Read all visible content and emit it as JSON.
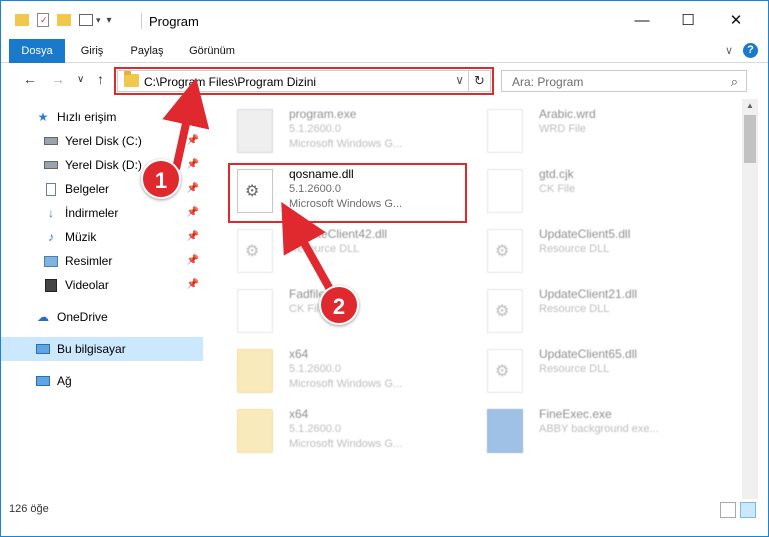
{
  "window": {
    "title": "Program",
    "controls": {
      "minimize": "—",
      "maximize": "☐",
      "close": "✕"
    }
  },
  "ribbon": {
    "tabs": [
      "Dosya",
      "Giriş",
      "Paylaş",
      "Görünüm"
    ],
    "chevron": "∨",
    "help": "?"
  },
  "address": {
    "path": "C:\\Program Files\\Program Dizini",
    "dropdown": "∨",
    "refresh": "↻"
  },
  "search": {
    "placeholder": "Ara: Program",
    "icon": "search-icon"
  },
  "nav": {
    "back": "←",
    "forward": "→",
    "recent": "∨",
    "up": "↑"
  },
  "sidebar": {
    "items": [
      {
        "label": "Hızlı erişim",
        "icon": "star-icon",
        "pinned": false
      },
      {
        "label": "Yerel Disk (C:)",
        "icon": "drive-icon",
        "pinned": true
      },
      {
        "label": "Yerel Disk (D:)",
        "icon": "drive-icon",
        "pinned": true
      },
      {
        "label": "Belgeler",
        "icon": "document-icon",
        "pinned": true
      },
      {
        "label": "İndirmeler",
        "icon": "download-icon",
        "pinned": true
      },
      {
        "label": "Müzik",
        "icon": "music-icon",
        "pinned": true
      },
      {
        "label": "Resimler",
        "icon": "pictures-icon",
        "pinned": true
      },
      {
        "label": "Videolar",
        "icon": "video-icon",
        "pinned": true
      },
      {
        "label": "OneDrive",
        "icon": "cloud-icon",
        "pinned": false
      },
      {
        "label": "Bu bilgisayar",
        "icon": "computer-icon",
        "pinned": false
      },
      {
        "label": "Ağ",
        "icon": "network-icon",
        "pinned": false
      }
    ]
  },
  "files": {
    "left": [
      {
        "name": "program.exe",
        "line1": "5.1.2600.0",
        "line2": "Microsoft Windows G...",
        "kind": "app"
      },
      {
        "name": "qosname.dll",
        "line1": "5.1.2600.0",
        "line2": "Microsoft Windows G...",
        "kind": "dll"
      },
      {
        "name": "UpdateClient42.dll",
        "line1": "Resource DLL",
        "line2": "",
        "kind": "dll"
      },
      {
        "name": "Fadfile.dll",
        "line1": "CK File",
        "line2": "",
        "kind": "blank"
      },
      {
        "name": "x64",
        "line1": "5.1.2600.0",
        "line2": "Microsoft Windows G...",
        "kind": "folder"
      },
      {
        "name": "x64",
        "line1": "5.1.2600.0",
        "line2": "Microsoft Windows G...",
        "kind": "folder"
      }
    ],
    "right": [
      {
        "name": "Arabic.wrd",
        "line1": "WRD File",
        "line2": "",
        "kind": "blank"
      },
      {
        "name": "gtd.cjk",
        "line1": "CK File",
        "line2": "",
        "kind": "blank"
      },
      {
        "name": "UpdateClient5.dll",
        "line1": "Resource DLL",
        "line2": "",
        "kind": "dll"
      },
      {
        "name": "UpdateClient21.dll",
        "line1": "Resource DLL",
        "line2": "",
        "kind": "dll"
      },
      {
        "name": "UpdateClient65.dll",
        "line1": "Resource DLL",
        "line2": "",
        "kind": "dll"
      },
      {
        "name": "FineExec.exe",
        "line1": "ABBY background exe...",
        "line2": "",
        "kind": "blue"
      }
    ]
  },
  "annotations": {
    "badge1": "1",
    "badge2": "2",
    "color": "#e0292e"
  },
  "status": {
    "count": "126 öğe"
  }
}
